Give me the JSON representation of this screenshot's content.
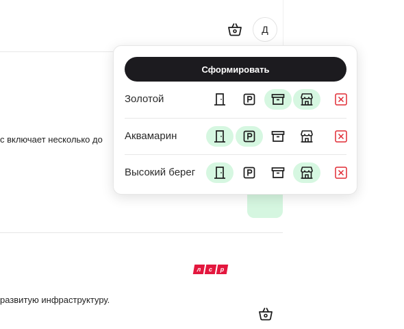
{
  "header": {
    "avatar_letter": "Д",
    "basket_icon": "basket-icon"
  },
  "background": {
    "text_fragment_1": "с включает несколько до",
    "text_fragment_2": "развитую инфраструктуру.",
    "logo_letters": [
      "л",
      "с",
      "р"
    ],
    "logo_color": "#e3173e"
  },
  "popover": {
    "form_button_label": "Сформировать",
    "rows": [
      {
        "label": "Золотой",
        "door": false,
        "parking": false,
        "storage": true,
        "shop": true
      },
      {
        "label": "Аквамарин",
        "door": true,
        "parking": true,
        "storage": false,
        "shop": false
      },
      {
        "label": "Высокий берег",
        "door": true,
        "parking": false,
        "storage": false,
        "shop": true
      }
    ],
    "icons": [
      "door-icon",
      "parking-icon",
      "storage-box-icon",
      "shop-icon",
      "remove-icon"
    ],
    "active_color": "#d6f7e1",
    "remove_color": "#e02a34"
  }
}
